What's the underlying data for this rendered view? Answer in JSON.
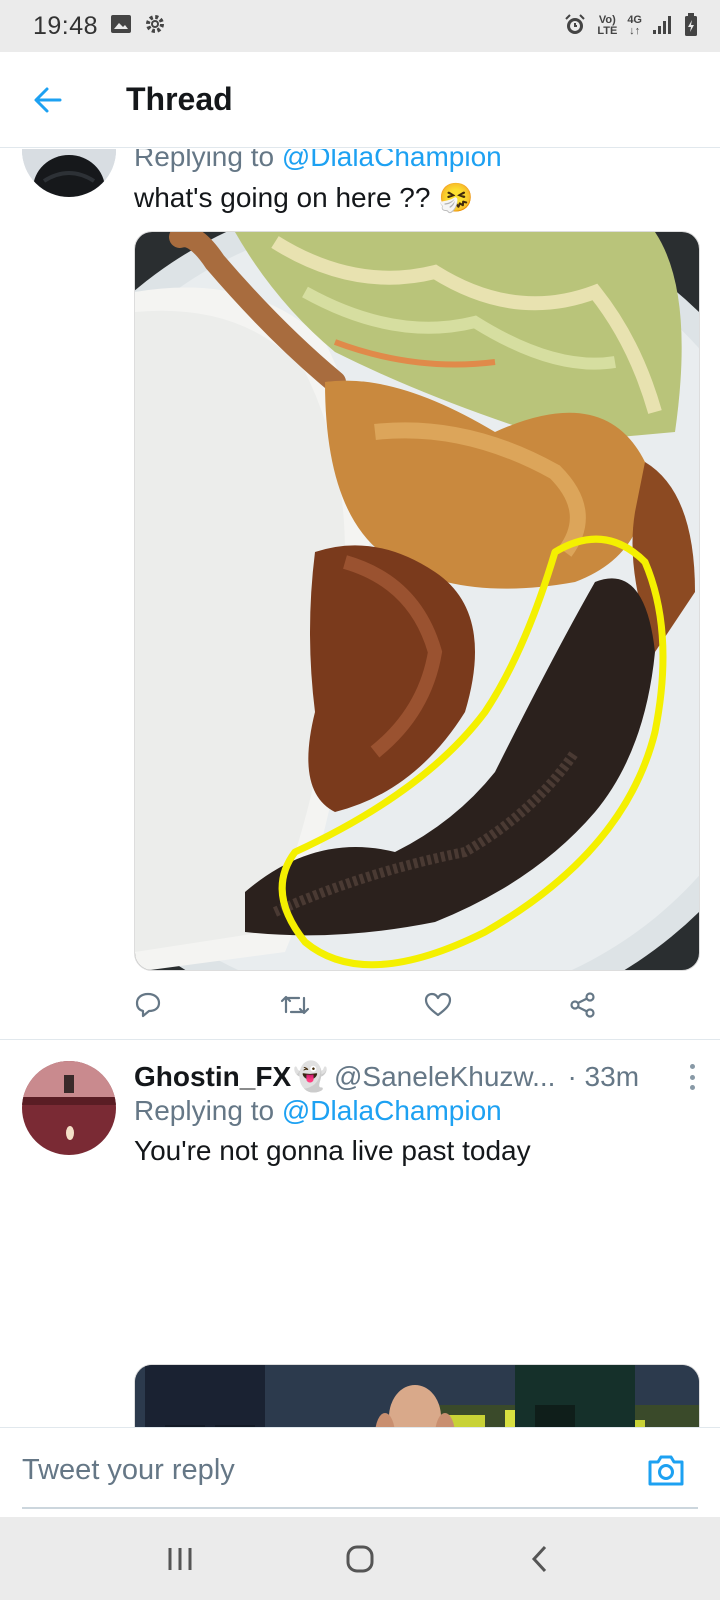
{
  "status_bar": {
    "time": "19:48",
    "left_icons": [
      "image-icon",
      "gear-icon"
    ],
    "network_top": "Vo)",
    "network_bottom": "LTE",
    "gen_top": "4G",
    "gen_bottom": "↓↑"
  },
  "header": {
    "title": "Thread"
  },
  "tweets": [
    {
      "replying_prefix": "Replying to",
      "replying_handle": "@DlalaChampion",
      "text": "what's going on here ??",
      "emoji": "🤧"
    },
    {
      "name": "Ghostin_FX",
      "name_emoji": "👻",
      "handle": "@SaneleKhuzw...",
      "time": "· 33m",
      "replying_prefix": "Replying to",
      "replying_handle": "@DlalaChampion",
      "text": "You're not gonna live past today"
    }
  ],
  "reply_bar": {
    "placeholder": "Tweet your reply"
  },
  "colors": {
    "accent": "#1da1f2",
    "secondary_text": "#657786",
    "annotation_yellow": "#f4f000"
  }
}
